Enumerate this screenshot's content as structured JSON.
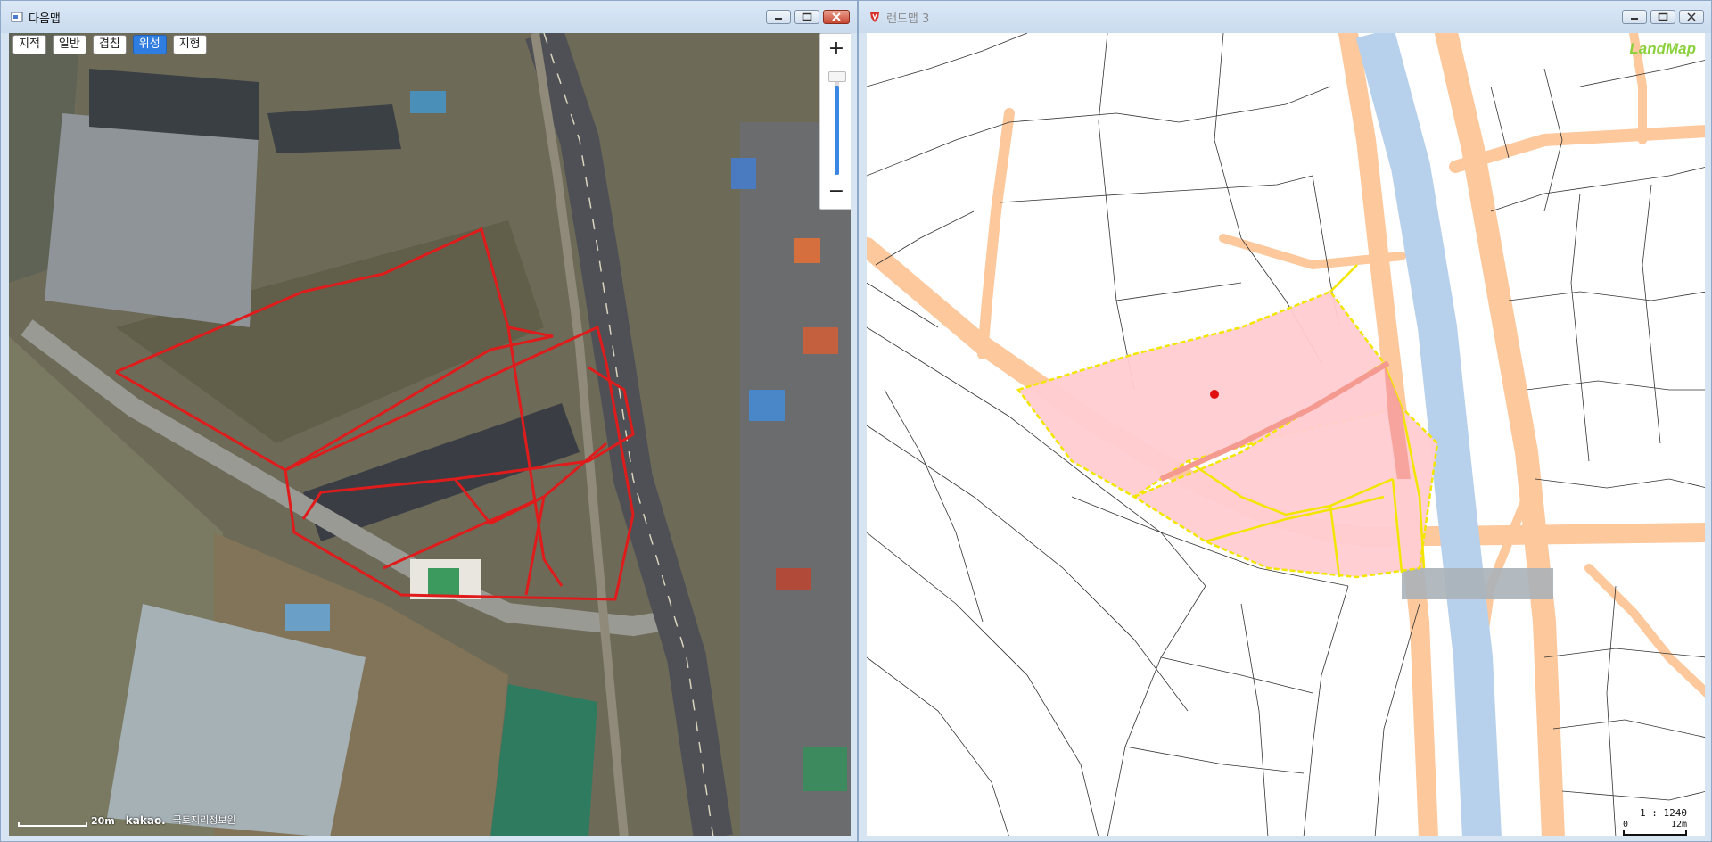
{
  "left_window": {
    "title": "다음맵",
    "tabs": [
      {
        "label": "지적",
        "active": false
      },
      {
        "label": "일반",
        "active": false
      },
      {
        "label": "겹침",
        "active": false
      },
      {
        "label": "위성",
        "active": true
      },
      {
        "label": "지형",
        "active": false
      }
    ],
    "zoom": {
      "plus": "+",
      "minus": "−"
    },
    "scale_label": "20m",
    "brand": "kakao.",
    "copyright": "국토지리정보원"
  },
  "right_window": {
    "title": "랜드맵 3",
    "logo": "LandMap",
    "scale_ratio": "1 : 1240",
    "scale_zero": "0",
    "scale_distance": "12m"
  },
  "colors": {
    "titlebar": "#d3e2f2",
    "active_tab": "#2f7de1",
    "parcel_outline_satellite": "#e01b1b",
    "parcel_fill_landmap": "#ffccd2",
    "parcel_outline_landmap": "#f2e600",
    "road": "#fcc89c",
    "river": "#b7d0eb",
    "logo": "#8bd13d"
  }
}
